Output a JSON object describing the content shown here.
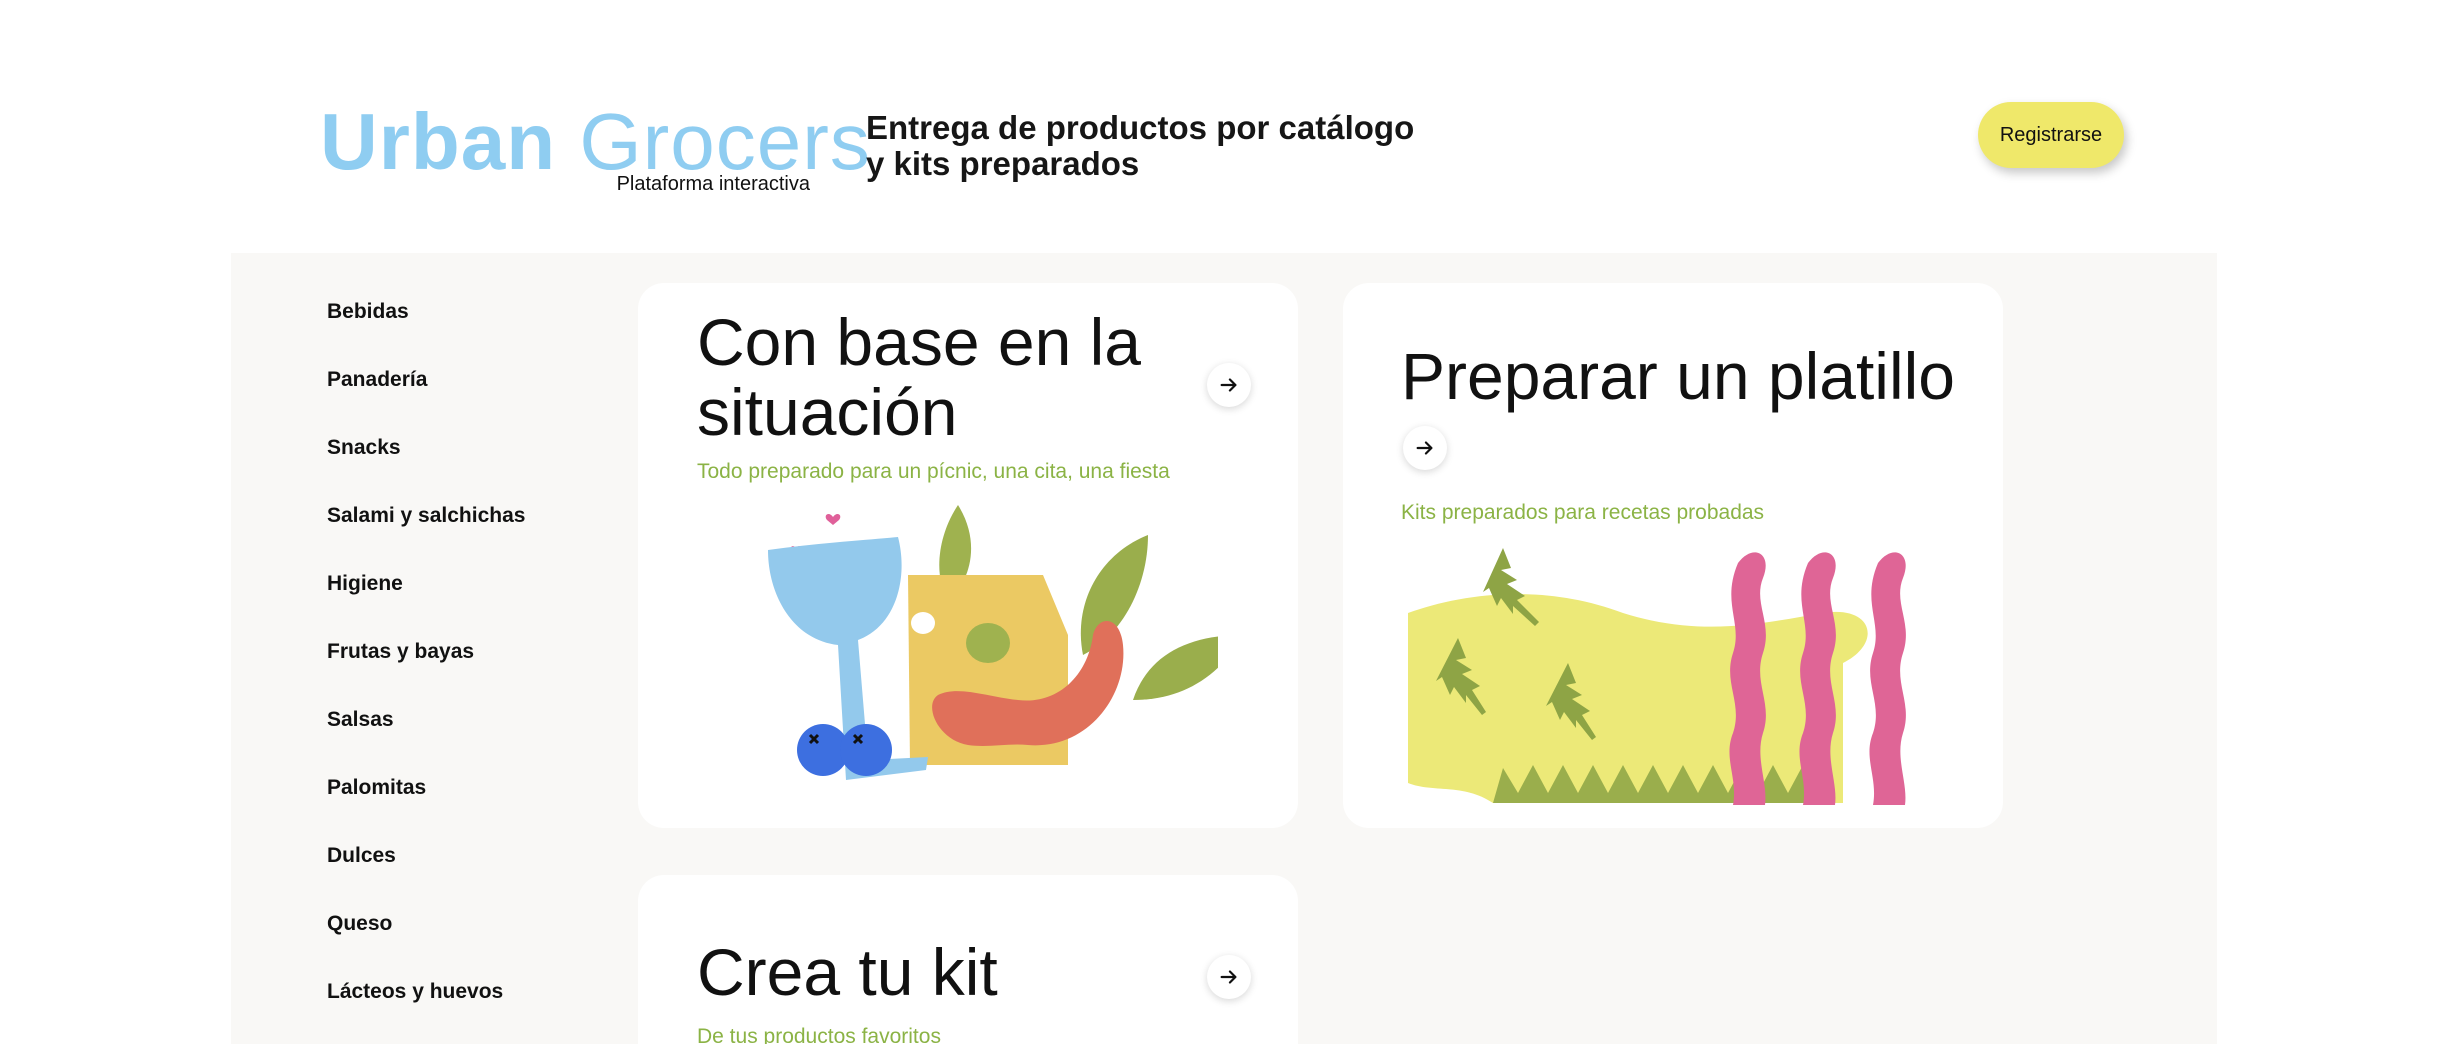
{
  "header": {
    "logo_bold": "Urban",
    "logo_light": "Grocers",
    "logo_subtitle": "Plataforma interactiva",
    "tagline_line1": "Entrega de productos por catálogo",
    "tagline_line2": "y kits preparados",
    "register_label": "Registrarse"
  },
  "sidebar": {
    "items": [
      {
        "label": "Bebidas"
      },
      {
        "label": "Panadería"
      },
      {
        "label": "Snacks"
      },
      {
        "label": "Salami y salchichas"
      },
      {
        "label": "Higiene"
      },
      {
        "label": "Frutas y bayas"
      },
      {
        "label": "Salsas"
      },
      {
        "label": "Palomitas"
      },
      {
        "label": "Dulces"
      },
      {
        "label": "Queso"
      },
      {
        "label": "Lácteos y huevos"
      }
    ]
  },
  "cards": [
    {
      "title": "Con base en la situación",
      "subtitle": "Todo preparado para un pícnic, una cita, una fiesta",
      "icon": "arrow-right-icon"
    },
    {
      "title": "Preparar un platillo",
      "subtitle": "Kits preparados para recetas probadas",
      "icon": "arrow-right-icon"
    },
    {
      "title": "Crea tu kit",
      "subtitle": "De tus productos favoritos",
      "icon": "arrow-right-icon"
    }
  ],
  "colors": {
    "brand_blue": "#8fcdf1",
    "accent_yellow": "#efe86a",
    "subtitle_green": "#8bb345",
    "main_background": "#f9f8f6"
  }
}
